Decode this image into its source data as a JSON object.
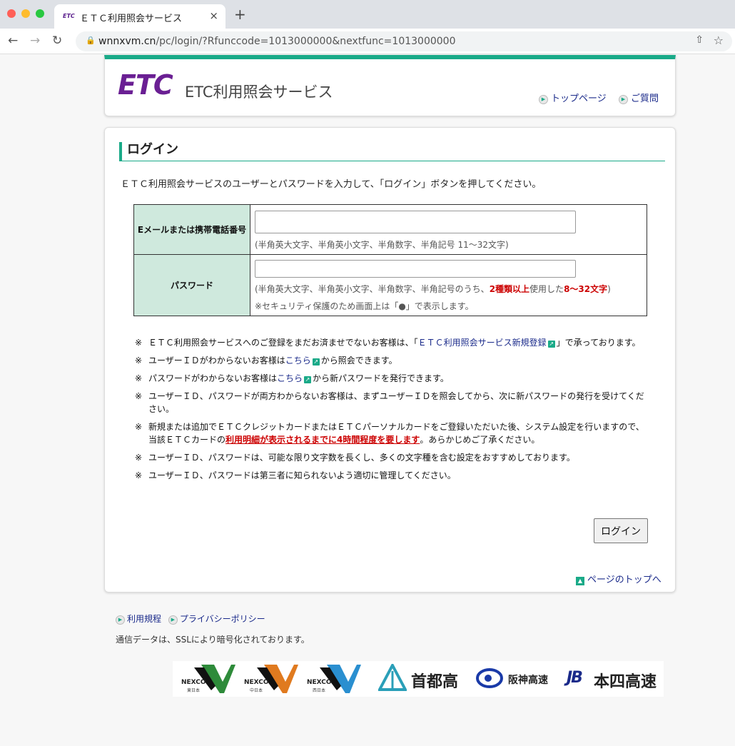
{
  "browser": {
    "tab_favicon": "ETC",
    "tab_title": "ＥＴＣ利用照会サービス",
    "tab_close": "×",
    "new_tab": "+",
    "url_host": "wnnxvm.cn",
    "url_path": "/pc/login/?Rfunccode=1013000000&nextfunc=1013000000"
  },
  "header": {
    "logo_mark": "ETC",
    "logo_text": "ETC利用照会サービス",
    "links": {
      "top_page": "トップページ",
      "faq": "ご質問"
    }
  },
  "login": {
    "heading": "ログイン",
    "intro": "ＥＴＣ利用照会サービスのユーザーとパスワードを入力して、「ログイン」ボタンを押してください。",
    "email_label": "Eメールまたは携帯電話番号",
    "email_value": "",
    "email_hint": "(半角英大文字、半角英小文字、半角数字、半角記号 11〜32文字)",
    "password_label": "パスワード",
    "password_value": "",
    "password_hint_a": "(半角英大文字、半角英小文字、半角数字、半角記号のうち、",
    "password_hint_b": "2種類以上",
    "password_hint_c": "使用した",
    "password_hint_d": "8〜32文字",
    "password_hint_e": ")",
    "security_note": "※セキュリティ保護のため画面上は「●」で表示します。",
    "submit_label": "ログイン"
  },
  "notes": {
    "mark": "※",
    "n1_a": "ＥＴＣ利用照会サービスへのご登録をまだお済ませでないお客様は、「",
    "n1_link": "ＥＴＣ利用照会サービス新規登録",
    "n1_b": "」で承っております。",
    "n2_a": "ユーザーＩＤがわからないお客様は",
    "n2_link": "こちら",
    "n2_b": "から照会できます。",
    "n3_a": "パスワードがわからないお客様は",
    "n3_link": "こちら",
    "n3_b": "から新パスワードを発行できます。",
    "n4": "ユーザーＩＤ、パスワードが両方わからないお客様は、まずユーザーＩＤを照会してから、次に新パスワードの発行を受けてください。",
    "n5_a": "新規または追加でＥＴＣクレジットカードまたはＥＴＣパーソナルカードをご登録いただいた後、システム設定を行いますので、当該ＥＴＣカードの",
    "n5_red": "利用明細が表示されるまでに4時間程度を要します",
    "n5_b": "。あらかじめご了承ください。",
    "n6": "ユーザーＩＤ、パスワードは、可能な限り文字数を長くし、多くの文字種を含む設定をおすすめしております。",
    "n7": "ユーザーＩＤ、パスワードは第三者に知られないよう適切に管理してください。"
  },
  "page_top": "ページのトップへ",
  "footer": {
    "terms": "利用規程",
    "privacy": "プライバシーポリシー",
    "ssl_note": "通信データは、SSLにより暗号化されております。"
  },
  "partner_logos": {
    "nexco_name": "NEXCO",
    "nexco_east": "東日本",
    "nexco_central": "中日本",
    "nexco_west": "西日本",
    "shutoko": "首都高",
    "hanshin": "阪神高速",
    "honshi_mark": "JB",
    "honshi": "本四高速"
  },
  "colors": {
    "brand_purple": "#6a1f93",
    "accent_green": "#1aaa88",
    "link_blue": "#1a2a8a",
    "warning_red": "#cc0000",
    "label_bg": "#cfe9dd"
  }
}
